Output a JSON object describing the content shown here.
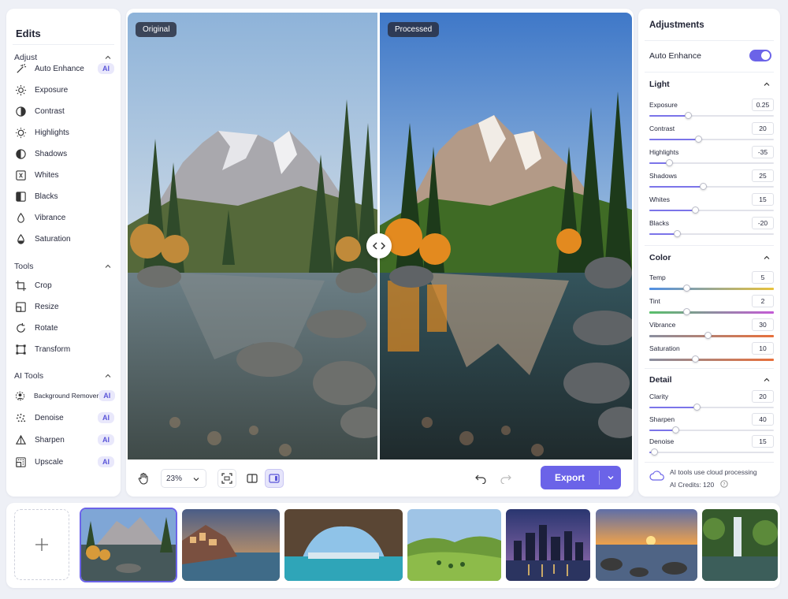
{
  "edits": {
    "title": "Edits",
    "adjust_title": "Adjust",
    "adjust_items": [
      {
        "label": "Auto Enhance",
        "icon": "magic-wand-icon",
        "badge": "AI"
      },
      {
        "label": "Exposure",
        "icon": "sun-icon"
      },
      {
        "label": "Contrast",
        "icon": "contrast-icon"
      },
      {
        "label": "Highlights",
        "icon": "highlights-icon"
      },
      {
        "label": "Shadows",
        "icon": "shadows-icon"
      },
      {
        "label": "Whites",
        "icon": "whites-icon"
      },
      {
        "label": "Blacks",
        "icon": "blacks-icon"
      },
      {
        "label": "Vibrance",
        "icon": "vibrance-icon"
      },
      {
        "label": "Saturation",
        "icon": "saturation-icon"
      }
    ],
    "tools_title": "Tools",
    "tools_items": [
      {
        "label": "Crop",
        "icon": "crop-icon"
      },
      {
        "label": "Resize",
        "icon": "resize-icon"
      },
      {
        "label": "Rotate",
        "icon": "rotate-icon"
      },
      {
        "label": "Transform",
        "icon": "transform-icon"
      }
    ],
    "ai_title": "AI Tools",
    "ai_items": [
      {
        "label": "Background Remover",
        "icon": "background-remover-icon",
        "badge": "AI"
      },
      {
        "label": "Denoise",
        "icon": "denoise-icon",
        "badge": "AI"
      },
      {
        "label": "Sharpen",
        "icon": "sharpen-icon",
        "badge": "AI"
      },
      {
        "label": "Upscale",
        "icon": "upscale-icon",
        "badge": "AI"
      }
    ]
  },
  "canvas": {
    "original_label": "Original",
    "processed_label": "Processed",
    "zoom": "23%",
    "export_label": "Export"
  },
  "adjustments": {
    "title": "Adjustments",
    "auto_enhance_label": "Auto Enhance",
    "auto_enhance_on": true,
    "light_title": "Light",
    "light": [
      {
        "label": "Exposure",
        "value": "0.25",
        "pos": 0.31
      },
      {
        "label": "Contrast",
        "value": "20",
        "pos": 0.39
      },
      {
        "label": "Highlights",
        "value": "-35",
        "pos": 0.16
      },
      {
        "label": "Shadows",
        "value": "25",
        "pos": 0.43
      },
      {
        "label": "Whites",
        "value": "15",
        "pos": 0.37
      },
      {
        "label": "Blacks",
        "value": "-20",
        "pos": 0.22
      }
    ],
    "color_title": "Color",
    "color": [
      {
        "label": "Temp",
        "value": "5",
        "pos": 0.3,
        "gradient": "linear-gradient(90deg,#4f8fe6,#e8c23b)"
      },
      {
        "label": "Tint",
        "value": "2",
        "pos": 0.3,
        "gradient": "linear-gradient(90deg,#58c06a,#c45ad6)"
      },
      {
        "label": "Vibrance",
        "value": "30",
        "pos": 0.47,
        "gradient": "linear-gradient(90deg,#8a8fa0,#e8703b)"
      },
      {
        "label": "Saturation",
        "value": "10",
        "pos": 0.37,
        "gradient": "linear-gradient(90deg,#8a8fa0,#e8703b)"
      }
    ],
    "detail_title": "Detail",
    "detail": [
      {
        "label": "Clarity",
        "value": "20",
        "pos": 0.38
      },
      {
        "label": "Sharpen",
        "value": "40",
        "pos": 0.21
      },
      {
        "label": "Denoise",
        "value": "15",
        "pos": 0.04
      }
    ],
    "cloud_note": "AI tools use cloud processing",
    "credits": "AI Credits: 120"
  },
  "colors": {
    "accent": "#6b63e8",
    "badge_bg": "#e9e8fb"
  }
}
